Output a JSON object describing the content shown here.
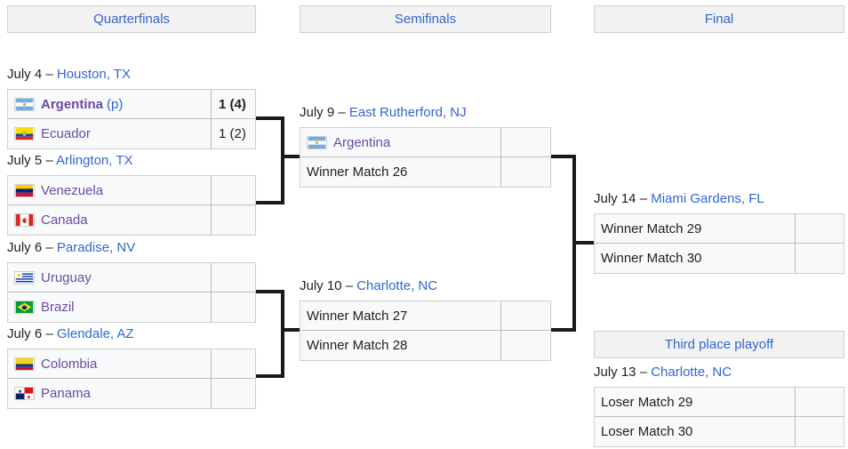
{
  "headers": [
    {
      "label": "Quarterfinals"
    },
    {
      "label": "Semifinals"
    },
    {
      "label": "Final"
    },
    {
      "label": "Third place playoff"
    }
  ],
  "quarterfinals": [
    {
      "date": "July 4 – ",
      "venue": "Houston, TX",
      "rows": [
        {
          "team": "Argentina",
          "flag": "argentina",
          "bold": true,
          "note": "(p)",
          "score": "1 (4)",
          "score_bold": true
        },
        {
          "team": "Ecuador",
          "flag": "ecuador",
          "bold": false,
          "note": "",
          "score": "1 (2)",
          "score_bold": false
        }
      ]
    },
    {
      "date": "July 5 – ",
      "venue": "Arlington, TX",
      "rows": [
        {
          "team": "Venezuela",
          "flag": "venezuela",
          "bold": false,
          "note": "",
          "score": "",
          "score_bold": false
        },
        {
          "team": "Canada",
          "flag": "canada",
          "bold": false,
          "note": "",
          "score": "",
          "score_bold": false
        }
      ]
    },
    {
      "date": "July 6 – ",
      "venue": "Paradise, NV",
      "rows": [
        {
          "team": "Uruguay",
          "flag": "uruguay",
          "bold": false,
          "note": "",
          "score": "",
          "score_bold": false
        },
        {
          "team": "Brazil",
          "flag": "brazil",
          "bold": false,
          "note": "",
          "score": "",
          "score_bold": false
        }
      ]
    },
    {
      "date": "July 6 – ",
      "venue": "Glendale, AZ",
      "rows": [
        {
          "team": "Colombia",
          "flag": "colombia",
          "bold": false,
          "note": "",
          "score": "",
          "score_bold": false
        },
        {
          "team": "Panama",
          "flag": "panama",
          "bold": false,
          "note": "",
          "score": "",
          "score_bold": false
        }
      ]
    }
  ],
  "semifinals": [
    {
      "date": "July 9 – ",
      "venue": "East Rutherford, NJ",
      "rows": [
        {
          "team": "Argentina",
          "flag": "argentina",
          "placeholder": false,
          "score": ""
        },
        {
          "team": "Winner Match 26",
          "flag": "",
          "placeholder": true,
          "score": ""
        }
      ]
    },
    {
      "date": "July 10 – ",
      "venue": "Charlotte, NC",
      "rows": [
        {
          "team": "Winner Match 27",
          "flag": "",
          "placeholder": true,
          "score": ""
        },
        {
          "team": "Winner Match 28",
          "flag": "",
          "placeholder": true,
          "score": ""
        }
      ]
    }
  ],
  "final": {
    "date": "July 14 – ",
    "venue": "Miami Gardens, FL",
    "rows": [
      {
        "team": "Winner Match 29",
        "placeholder": true,
        "score": ""
      },
      {
        "team": "Winner Match 30",
        "placeholder": true,
        "score": ""
      }
    ]
  },
  "third_place": {
    "date": "July 13 – ",
    "venue": "Charlotte, NC",
    "rows": [
      {
        "team": "Loser Match 29",
        "placeholder": true,
        "score": ""
      },
      {
        "team": "Loser Match 30",
        "placeholder": true,
        "score": ""
      }
    ]
  },
  "colors": {
    "link": "#3366cc",
    "visited_link": "#6b4ba1",
    "header_bg": "#f2f2f2",
    "cell_bg": "#f8f9fa",
    "connector": "#1a1a1a"
  }
}
